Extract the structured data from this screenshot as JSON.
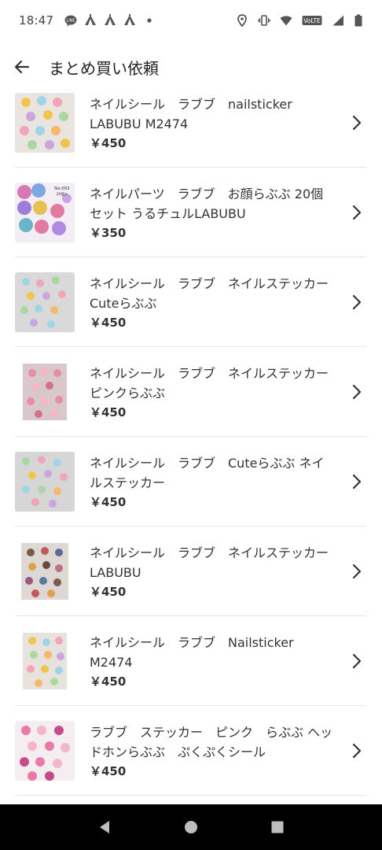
{
  "status": {
    "time": "18:47",
    "left_icons": [
      "line-icon",
      "tent-icon",
      "tent-icon",
      "tent-icon",
      "dot-icon"
    ],
    "right_icons": [
      "location-icon",
      "vibrate-icon",
      "wifi-icon",
      "volte-icon",
      "signal-icon",
      "battery-icon"
    ],
    "volte_label": "VoLTE"
  },
  "header": {
    "title": "まとめ買い依頼",
    "back_icon": "arrow-left-icon"
  },
  "items": [
    {
      "title": "ネイルシール　ラブブ　nailsticker LABUBU M2474",
      "price": "￥450"
    },
    {
      "title": "ネイルパーツ　ラブブ　お顔らぶぶ 20個セット うるチュルLABUBU",
      "price": "￥350",
      "badge1": "No.002",
      "badge2": "20個入"
    },
    {
      "title": "ネイルシール　ラブブ　ネイルステッカー　Cuteらぶぶ",
      "price": "￥450"
    },
    {
      "title": "ネイルシール　ラブブ　ネイルステッカー　ピンクらぶぶ",
      "price": "￥450"
    },
    {
      "title": "ネイルシール　ラブブ　Cuteらぶぶ ネイルステッカー",
      "price": "￥450"
    },
    {
      "title": "ネイルシール　ラブブ　ネイルステッカー LABUBU",
      "price": "￥450"
    },
    {
      "title": "ネイルシール　ラブブ　Nailsticker M2474",
      "price": "￥450"
    },
    {
      "title": "ラブブ　ステッカー　ピンク　らぶぶ ヘッドホンらぶぶ　ぷくぷくシール",
      "price": "￥450"
    }
  ],
  "nav": {
    "back": "nav-back-icon",
    "home": "nav-home-icon",
    "recents": "nav-recents-icon"
  }
}
